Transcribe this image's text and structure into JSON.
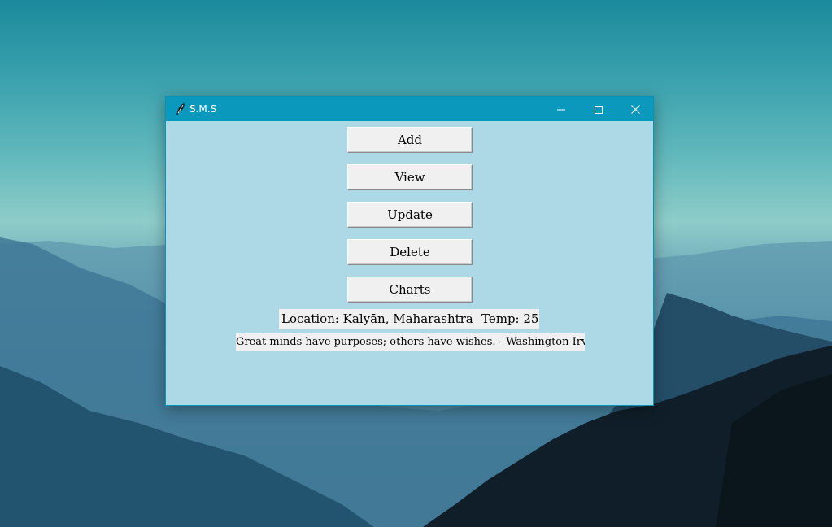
{
  "window": {
    "title": "S.M.S",
    "accent_color": "#0a99bd",
    "background_color": "#add8e6"
  },
  "titlebar_controls": {
    "minimize_icon": "minimize-icon",
    "maximize_icon": "maximize-icon",
    "close_icon": "close-icon"
  },
  "app_icon": "feather-icon",
  "buttons": {
    "add": "Add",
    "view": "View",
    "update": "Update",
    "delete": "Delete",
    "charts": "Charts"
  },
  "info": {
    "location": "Location: Kalyān, Maharashtra",
    "temp": "Temp: 25"
  },
  "quote": "Great minds have purposes; others have wishes. - Washington Irving"
}
